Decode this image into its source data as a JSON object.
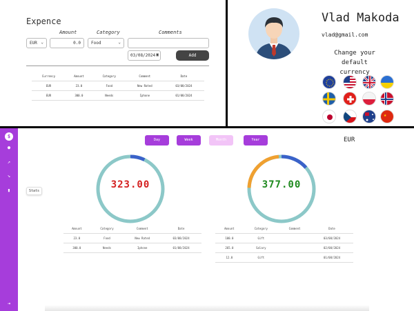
{
  "expense": {
    "title": "Expence",
    "amount_label": "Amount",
    "category_label": "Category",
    "comments_label": "Comments",
    "currency_value": "EUR",
    "amount_value": "0.0",
    "category_value": "Food",
    "date_value": "03/08/2024",
    "add_label": "Add",
    "columns": [
      "Currency",
      "Amount",
      "Category",
      "Comment",
      "Date"
    ],
    "rows": [
      [
        "EUR",
        "23.0",
        "Food",
        "New Rated",
        "03/08/2024"
      ],
      [
        "EUR",
        "300.0",
        "Needs",
        "Iphone",
        "01/08/2024"
      ]
    ]
  },
  "profile": {
    "name": "Vlad Makoda",
    "email": "vlad@gmail.com",
    "change_line1": "Change your default",
    "change_line2": "currency",
    "flags": [
      "eu",
      "us",
      "uk",
      "ua",
      "se",
      "ch",
      "pl",
      "no",
      "jp",
      "cz",
      "au",
      "cn"
    ]
  },
  "dashboard": {
    "stats_tooltip": "Stats",
    "periods": [
      "Day",
      "Week",
      "Month",
      "Year"
    ],
    "selected_period": "Month",
    "currency": "EUR",
    "expense_total": "323.00",
    "income_total": "377.00",
    "colors": {
      "accent": "#a63ddb",
      "ring": "#8cc8c8",
      "blue": "#3a62c9",
      "orange": "#f0a030",
      "red": "#d42020",
      "green": "#1f8a1f"
    },
    "expense_table": {
      "columns": [
        "Amount",
        "Category",
        "Comment",
        "Date"
      ],
      "rows": [
        [
          "23.0",
          "Food",
          "New Rated",
          "03/08/2024"
        ],
        [
          "300.0",
          "Needs",
          "Iphone",
          "01/08/2024"
        ]
      ]
    },
    "income_table": {
      "columns": [
        "Amount",
        "Category",
        "Comment",
        "Date"
      ],
      "rows": [
        [
          "100.0",
          "Gift",
          "",
          "03/08/2024"
        ],
        [
          "265.0",
          "Salary",
          "",
          "02/08/2024"
        ],
        [
          "12.0",
          "Gift",
          "",
          "01/08/2024"
        ]
      ]
    },
    "sidebar_icons": [
      "logo-icon",
      "user-icon",
      "chart-up-icon",
      "chart-down-icon",
      "stats-icon",
      "logout-icon"
    ]
  }
}
